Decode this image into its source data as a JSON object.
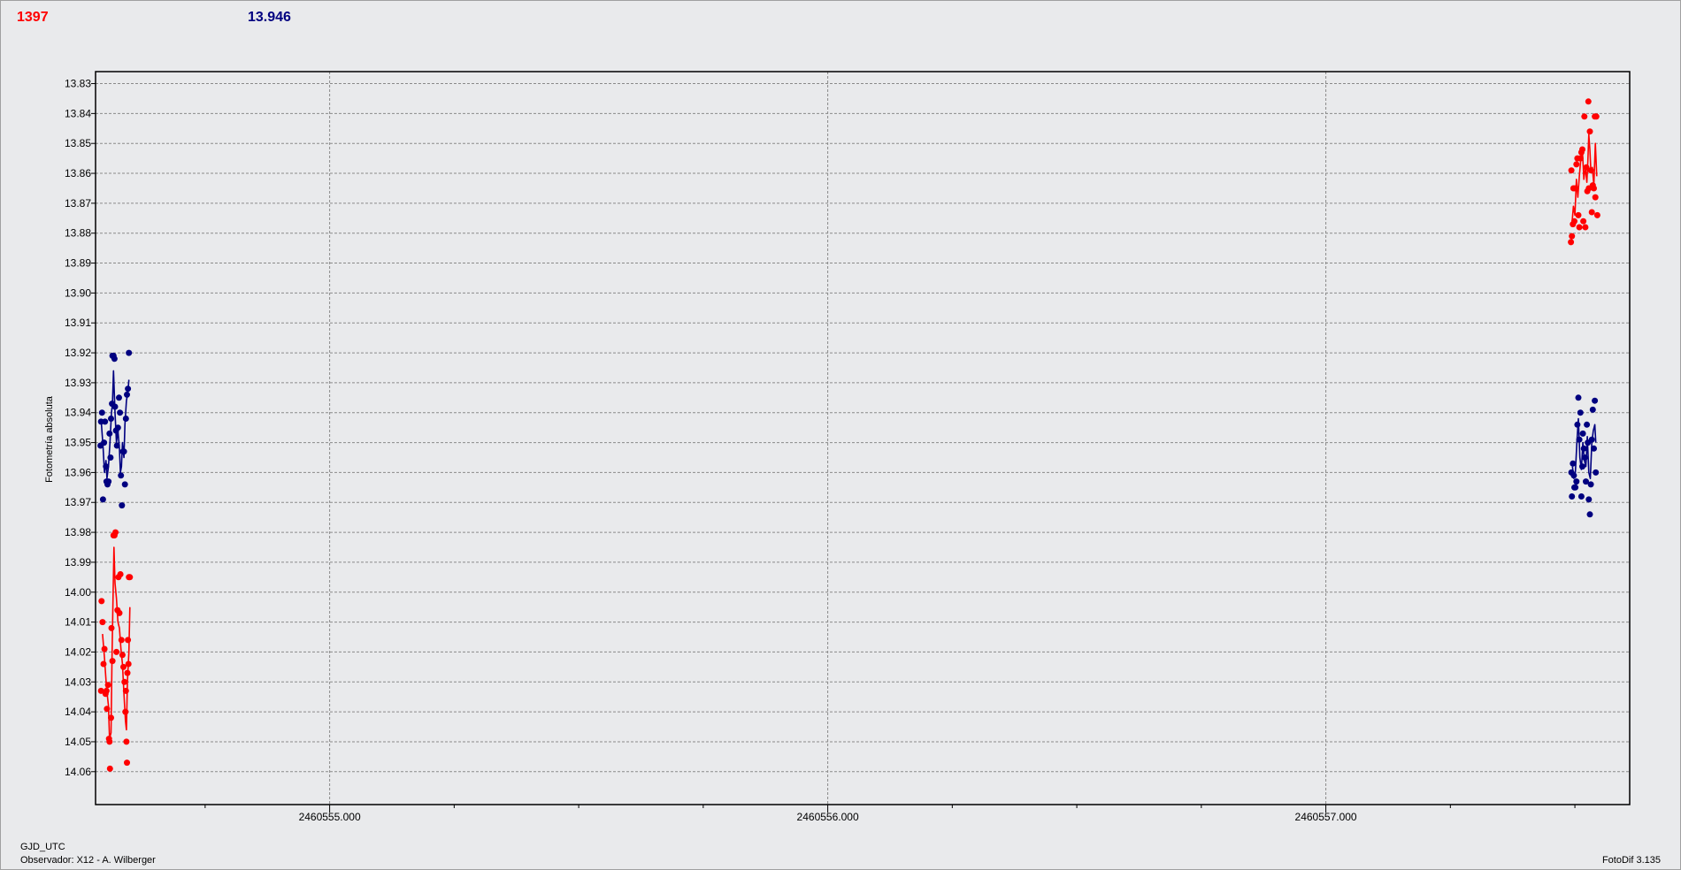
{
  "header": {
    "value_red": "1397",
    "value_blue": "13.946",
    "color_red": "#ff0000",
    "color_blue": "#000080"
  },
  "footer": {
    "xlabel": "GJD_UTC",
    "observer": "Observador: X12 - A. Wilberger",
    "version": "FotoDif 3.135"
  },
  "chart_data": {
    "type": "scatter",
    "title": "",
    "xlabel": "GJD_UTC",
    "ylabel": "Fotometría absoluta",
    "xlim": [
      2460554.53,
      2460557.61
    ],
    "ylim": [
      13.826,
      14.071
    ],
    "y_inverted": true,
    "grid": true,
    "x_ticks": [
      2460555.0,
      2460556.0,
      2460557.0
    ],
    "x_tick_labels": [
      "2460555.000",
      "2460556.000",
      "2460557.000"
    ],
    "x_minor_ticks": [
      2460554.75,
      2460555.25,
      2460555.5,
      2460555.75,
      2460556.25,
      2460556.5,
      2460556.75,
      2460557.25,
      2460557.5
    ],
    "y_ticks": [
      13.83,
      13.84,
      13.85,
      13.86,
      13.87,
      13.88,
      13.89,
      13.9,
      13.91,
      13.92,
      13.93,
      13.94,
      13.95,
      13.96,
      13.97,
      13.98,
      13.99,
      14.0,
      14.01,
      14.02,
      14.03,
      14.04,
      14.05,
      14.06
    ],
    "y_tick_labels": [
      "13.83",
      "13.84",
      "13.85",
      "13.86",
      "13.87",
      "13.88",
      "13.89",
      "13.90",
      "13.91",
      "13.92",
      "13.93",
      "13.94",
      "13.95",
      "13.96",
      "13.97",
      "13.98",
      "13.99",
      "14.00",
      "14.01",
      "14.02",
      "14.03",
      "14.04",
      "14.05",
      "14.06"
    ],
    "series": [
      {
        "color": "#ff0000",
        "points": [
          [
            2460554.541,
            14.033
          ],
          [
            2460554.542,
            14.003
          ],
          [
            2460554.544,
            14.01
          ],
          [
            2460554.546,
            14.024
          ],
          [
            2460554.548,
            14.019
          ],
          [
            2460554.55,
            14.034
          ],
          [
            2460554.552,
            14.033
          ],
          [
            2460554.553,
            14.039
          ],
          [
            2460554.555,
            14.031
          ],
          [
            2460554.557,
            14.049
          ],
          [
            2460554.558,
            14.05
          ],
          [
            2460554.559,
            14.059
          ],
          [
            2460554.561,
            14.042
          ],
          [
            2460554.562,
            14.012
          ],
          [
            2460554.564,
            14.023
          ],
          [
            2460554.566,
            13.981
          ],
          [
            2460554.568,
            13.981
          ],
          [
            2460554.57,
            13.98
          ],
          [
            2460554.572,
            14.02
          ],
          [
            2460554.574,
            14.006
          ],
          [
            2460554.576,
            13.995
          ],
          [
            2460554.578,
            14.007
          ],
          [
            2460554.58,
            13.994
          ],
          [
            2460554.582,
            14.016
          ],
          [
            2460554.584,
            14.021
          ],
          [
            2460554.586,
            14.025
          ],
          [
            2460554.588,
            14.03
          ],
          [
            2460554.59,
            14.04
          ],
          [
            2460554.591,
            14.033
          ],
          [
            2460554.592,
            14.05
          ],
          [
            2460554.593,
            14.057
          ],
          [
            2460554.594,
            14.027
          ],
          [
            2460554.595,
            14.016
          ],
          [
            2460554.596,
            14.024
          ],
          [
            2460554.597,
            13.995
          ],
          [
            2460554.599,
            13.995
          ]
        ],
        "line": [
          [
            2460554.544,
            14.014
          ],
          [
            2460554.548,
            14.022
          ],
          [
            2460554.552,
            14.032
          ],
          [
            2460554.556,
            14.038
          ],
          [
            2460554.558,
            14.049
          ],
          [
            2460554.561,
            14.047
          ],
          [
            2460554.563,
            14.022
          ],
          [
            2460554.565,
            14.003
          ],
          [
            2460554.567,
            13.985
          ],
          [
            2460554.569,
            13.997
          ],
          [
            2460554.572,
            14.002
          ],
          [
            2460554.575,
            14.01
          ],
          [
            2460554.578,
            14.012
          ],
          [
            2460554.581,
            14.019
          ],
          [
            2460554.584,
            14.024
          ],
          [
            2460554.587,
            14.034
          ],
          [
            2460554.59,
            14.043
          ],
          [
            2460554.592,
            14.046
          ],
          [
            2460554.594,
            14.03
          ],
          [
            2460554.597,
            14.02
          ],
          [
            2460554.599,
            14.005
          ]
        ]
      },
      {
        "color": "#000080",
        "points": [
          [
            2460554.54,
            13.951
          ],
          [
            2460554.541,
            13.943
          ],
          [
            2460554.543,
            13.94
          ],
          [
            2460554.545,
            13.969
          ],
          [
            2460554.547,
            13.95
          ],
          [
            2460554.549,
            13.943
          ],
          [
            2460554.551,
            13.958
          ],
          [
            2460554.552,
            13.963
          ],
          [
            2460554.554,
            13.964
          ],
          [
            2460554.556,
            13.963
          ],
          [
            2460554.558,
            13.947
          ],
          [
            2460554.56,
            13.955
          ],
          [
            2460554.561,
            13.942
          ],
          [
            2460554.563,
            13.937
          ],
          [
            2460554.564,
            13.921
          ],
          [
            2460554.566,
            13.921
          ],
          [
            2460554.568,
            13.922
          ],
          [
            2460554.569,
            13.938
          ],
          [
            2460554.571,
            13.946
          ],
          [
            2460554.573,
            13.951
          ],
          [
            2460554.575,
            13.945
          ],
          [
            2460554.577,
            13.935
          ],
          [
            2460554.579,
            13.94
          ],
          [
            2460554.581,
            13.961
          ],
          [
            2460554.583,
            13.971
          ],
          [
            2460554.585,
            13.953
          ],
          [
            2460554.587,
            13.953
          ],
          [
            2460554.589,
            13.964
          ],
          [
            2460554.591,
            13.942
          ],
          [
            2460554.593,
            13.934
          ],
          [
            2460554.595,
            13.932
          ],
          [
            2460554.597,
            13.92
          ]
        ],
        "line": [
          [
            2460554.541,
            13.942
          ],
          [
            2460554.545,
            13.951
          ],
          [
            2460554.548,
            13.96
          ],
          [
            2460554.551,
            13.956
          ],
          [
            2460554.553,
            13.962
          ],
          [
            2460554.556,
            13.958
          ],
          [
            2460554.559,
            13.95
          ],
          [
            2460554.562,
            13.94
          ],
          [
            2460554.564,
            13.937
          ],
          [
            2460554.566,
            13.926
          ],
          [
            2460554.569,
            13.94
          ],
          [
            2460554.572,
            13.95
          ],
          [
            2460554.575,
            13.946
          ],
          [
            2460554.578,
            13.952
          ],
          [
            2460554.58,
            13.96
          ],
          [
            2460554.582,
            13.958
          ],
          [
            2460554.584,
            13.95
          ],
          [
            2460554.587,
            13.955
          ],
          [
            2460554.589,
            13.944
          ],
          [
            2460554.592,
            13.936
          ],
          [
            2460554.595,
            13.933
          ],
          [
            2460554.597,
            13.929
          ]
        ]
      },
      {
        "color": "#ff0000",
        "points": [
          [
            2460557.492,
            13.883
          ],
          [
            2460557.493,
            13.859
          ],
          [
            2460557.494,
            13.881
          ],
          [
            2460557.496,
            13.877
          ],
          [
            2460557.497,
            13.865
          ],
          [
            2460557.499,
            13.876
          ],
          [
            2460557.501,
            13.865
          ],
          [
            2460557.503,
            13.857
          ],
          [
            2460557.505,
            13.855
          ],
          [
            2460557.507,
            13.874
          ],
          [
            2460557.509,
            13.878
          ],
          [
            2460557.511,
            13.855
          ],
          [
            2460557.513,
            13.853
          ],
          [
            2460557.515,
            13.852
          ],
          [
            2460557.517,
            13.876
          ],
          [
            2460557.519,
            13.841
          ],
          [
            2460557.521,
            13.878
          ],
          [
            2460557.523,
            13.858
          ],
          [
            2460557.525,
            13.866
          ],
          [
            2460557.527,
            13.836
          ],
          [
            2460557.528,
            13.865
          ],
          [
            2460557.53,
            13.846
          ],
          [
            2460557.532,
            13.859
          ],
          [
            2460557.534,
            13.873
          ],
          [
            2460557.536,
            13.864
          ],
          [
            2460557.538,
            13.865
          ],
          [
            2460557.54,
            13.841
          ],
          [
            2460557.541,
            13.868
          ],
          [
            2460557.543,
            13.841
          ],
          [
            2460557.545,
            13.874
          ]
        ],
        "line": [
          [
            2460557.494,
            13.877
          ],
          [
            2460557.497,
            13.871
          ],
          [
            2460557.5,
            13.874
          ],
          [
            2460557.503,
            13.862
          ],
          [
            2460557.506,
            13.868
          ],
          [
            2460557.509,
            13.861
          ],
          [
            2460557.512,
            13.855
          ],
          [
            2460557.515,
            13.852
          ],
          [
            2460557.518,
            13.862
          ],
          [
            2460557.521,
            13.858
          ],
          [
            2460557.524,
            13.863
          ],
          [
            2460557.526,
            13.856
          ],
          [
            2460557.528,
            13.847
          ],
          [
            2460557.53,
            13.852
          ],
          [
            2460557.532,
            13.859
          ],
          [
            2460557.535,
            13.858
          ],
          [
            2460557.538,
            13.864
          ],
          [
            2460557.541,
            13.85
          ],
          [
            2460557.544,
            13.861
          ]
        ]
      },
      {
        "color": "#000080",
        "points": [
          [
            2460557.493,
            13.96
          ],
          [
            2460557.494,
            13.968
          ],
          [
            2460557.496,
            13.957
          ],
          [
            2460557.498,
            13.961
          ],
          [
            2460557.499,
            13.965
          ],
          [
            2460557.501,
            13.965
          ],
          [
            2460557.503,
            13.963
          ],
          [
            2460557.505,
            13.944
          ],
          [
            2460557.507,
            13.935
          ],
          [
            2460557.509,
            13.949
          ],
          [
            2460557.511,
            13.94
          ],
          [
            2460557.513,
            13.968
          ],
          [
            2460557.515,
            13.958
          ],
          [
            2460557.516,
            13.947
          ],
          [
            2460557.518,
            13.952
          ],
          [
            2460557.52,
            13.955
          ],
          [
            2460557.522,
            13.963
          ],
          [
            2460557.524,
            13.944
          ],
          [
            2460557.526,
            13.95
          ],
          [
            2460557.528,
            13.969
          ],
          [
            2460557.53,
            13.974
          ],
          [
            2460557.532,
            13.964
          ],
          [
            2460557.534,
            13.949
          ],
          [
            2460557.536,
            13.939
          ],
          [
            2460557.538,
            13.952
          ],
          [
            2460557.54,
            13.936
          ],
          [
            2460557.542,
            13.96
          ]
        ],
        "line": [
          [
            2460557.495,
            13.958
          ],
          [
            2460557.498,
            13.962
          ],
          [
            2460557.501,
            13.96
          ],
          [
            2460557.504,
            13.95
          ],
          [
            2460557.507,
            13.942
          ],
          [
            2460557.51,
            13.955
          ],
          [
            2460557.513,
            13.959
          ],
          [
            2460557.516,
            13.95
          ],
          [
            2460557.519,
            13.956
          ],
          [
            2460557.522,
            13.958
          ],
          [
            2460557.525,
            13.948
          ],
          [
            2460557.528,
            13.96
          ],
          [
            2460557.531,
            13.962
          ],
          [
            2460557.534,
            13.95
          ],
          [
            2460557.537,
            13.946
          ],
          [
            2460557.54,
            13.944
          ],
          [
            2460557.542,
            13.95
          ]
        ]
      }
    ]
  }
}
